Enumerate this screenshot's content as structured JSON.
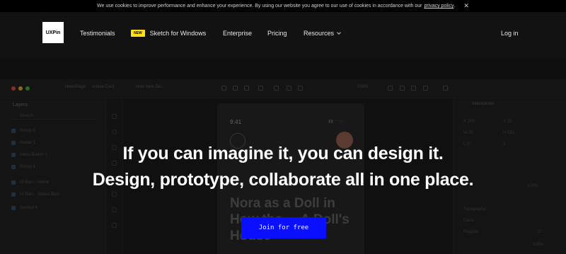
{
  "cookie_bar": {
    "text": "We use cookies to improve performance and enhance your experience. By using our website you agree to our use of cookies in accordance with our",
    "link": "privacy policy",
    "suffix": ".",
    "close": "✕"
  },
  "nav": {
    "logo": "UXPin",
    "items": [
      {
        "label": "Testimonials"
      },
      {
        "badge": "NEW",
        "label": "Sketch for Windows"
      },
      {
        "label": "Enterprise"
      },
      {
        "label": "Pricing"
      },
      {
        "label": "Resources"
      }
    ],
    "login": "Log in"
  },
  "mockup": {
    "breadcrumbs": [
      "NewsPage",
      "Article Card",
      "How New Zel..."
    ],
    "zoom": "100%",
    "layers_title": "Layers",
    "search_placeholder": "Search",
    "layers": [
      "Group 5",
      "Avatar 1",
      "Menu Button 1",
      "Group 4",
      "UI Bars - Home",
      "UI Bars - Status Bars",
      "Symbol 4"
    ],
    "phone_time": "9:41",
    "phone_headline": "Nora as a Doll in How the ... A Doll's House",
    "interactions_title": "Interactions",
    "props": [
      "X 159",
      "Y 18",
      "W 35",
      "H 581",
      "L 0°",
      "1",
      "100%",
      "Typography",
      "Carla",
      "Regular",
      "20",
      "100%"
    ]
  },
  "hero": {
    "line1": "If you can imagine it, you can design it.",
    "line2": "Design, prototype, collaborate all in one place.",
    "cta": "Join for free"
  },
  "colors": {
    "cta": "#0a10ff",
    "badge": "#ffe11a",
    "background": "#171717"
  }
}
